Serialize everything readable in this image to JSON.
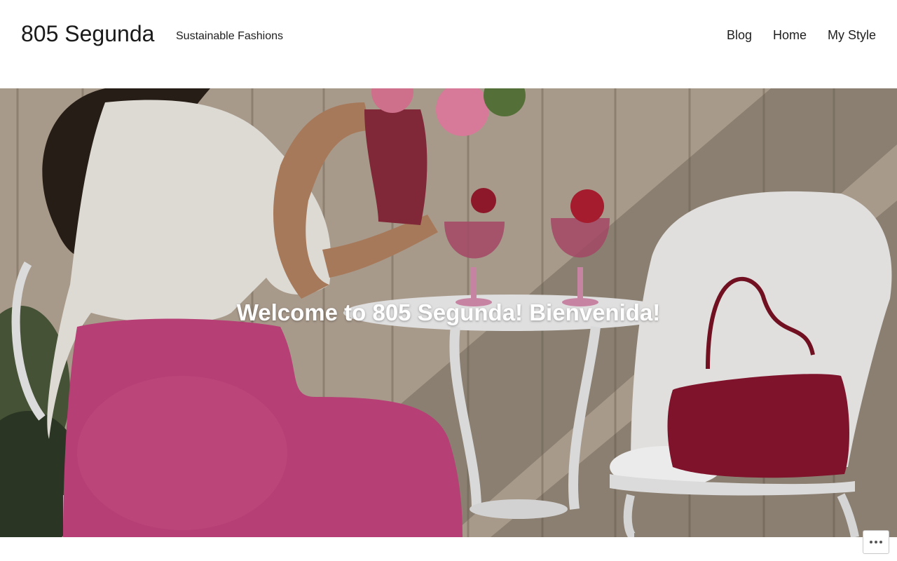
{
  "header": {
    "site_title": "805 Segunda",
    "tagline": "Sustainable Fashions"
  },
  "nav": {
    "items": [
      {
        "label": "Blog"
      },
      {
        "label": "Home"
      },
      {
        "label": "My Style"
      }
    ]
  },
  "hero": {
    "heading": "Welcome to 805 Segunda! Bienvenida!",
    "image_alt_icon": "photo-icon"
  },
  "actions": {
    "more_icon": "ellipsis-icon"
  },
  "colors": {
    "background": "#ffffff",
    "text": "#1e1e1e",
    "hero_heading": "#ffffff"
  }
}
